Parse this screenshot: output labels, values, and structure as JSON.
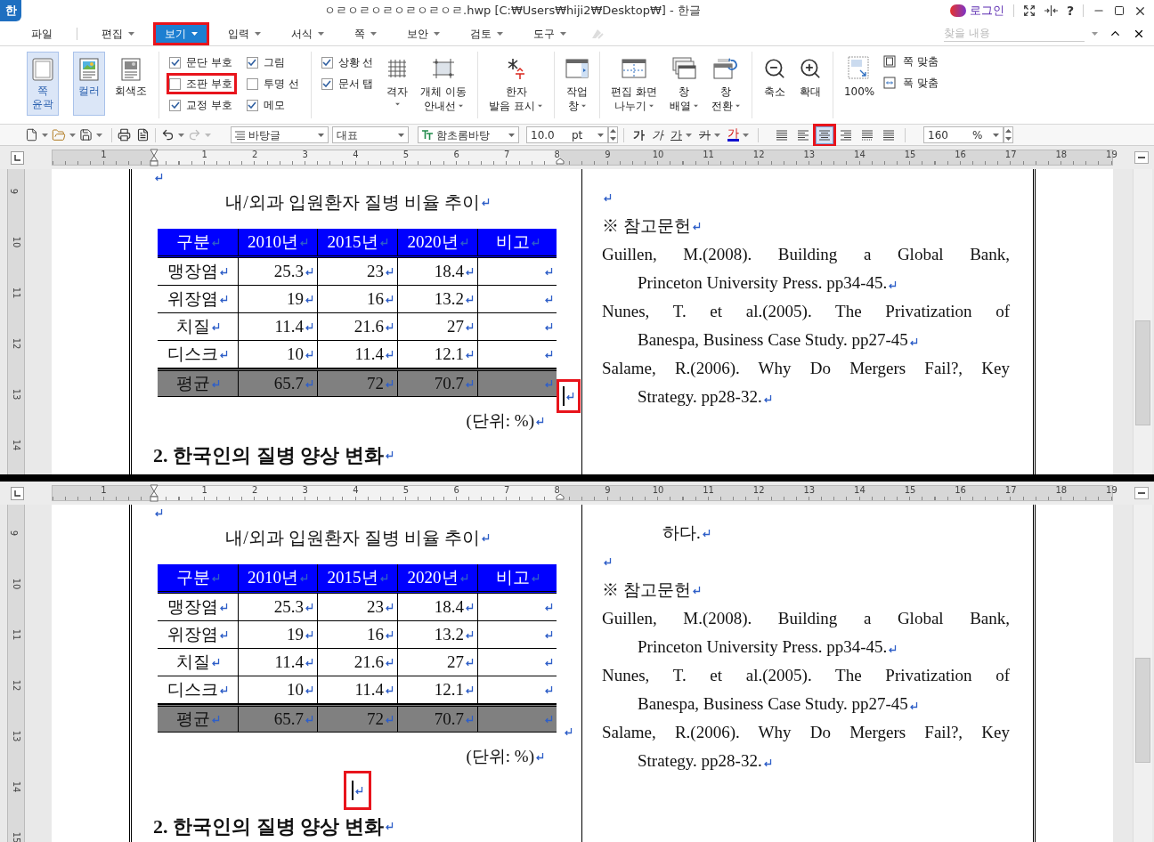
{
  "window": {
    "logo": "한",
    "title": "ㅇㄹㅇㄹㅇㄹㅇㄹㅇㄹㅇㄹ.hwp [C:₩Users₩hiji2₩Desktop₩] - 한글",
    "login": "로그인",
    "help": "?"
  },
  "menu": [
    {
      "label": "파일",
      "dropdown": false,
      "selected": false,
      "highlighted": false
    },
    {
      "label": "편집",
      "dropdown": true,
      "selected": false,
      "highlighted": false
    },
    {
      "label": "보기",
      "dropdown": true,
      "selected": true,
      "highlighted": true
    },
    {
      "label": "입력",
      "dropdown": true,
      "selected": false,
      "highlighted": false
    },
    {
      "label": "서식",
      "dropdown": true,
      "selected": false,
      "highlighted": false
    },
    {
      "label": "쪽",
      "dropdown": true,
      "selected": false,
      "highlighted": false
    },
    {
      "label": "보안",
      "dropdown": true,
      "selected": false,
      "highlighted": false
    },
    {
      "label": "검토",
      "dropdown": true,
      "selected": false,
      "highlighted": false
    },
    {
      "label": "도구",
      "dropdown": true,
      "selected": false,
      "highlighted": false
    }
  ],
  "search": {
    "placeholder": "찾을 내용"
  },
  "ribbon": {
    "groups": [
      {
        "toggles": [
          {
            "lines": [
              "쪽",
              "윤곽"
            ],
            "selected": true
          }
        ]
      },
      {
        "toggles": [
          {
            "lines": [
              "컬러"
            ],
            "selected": true
          },
          {
            "lines": [
              "회색조"
            ],
            "selected": false
          }
        ]
      },
      {
        "checks": [
          {
            "label": "문단 부호",
            "checked": true,
            "highlighted": false
          },
          {
            "label": "조판 부호",
            "checked": false,
            "highlighted": true
          },
          {
            "label": "교정 부호",
            "checked": true,
            "highlighted": false
          },
          {
            "label": "그림",
            "checked": true,
            "highlighted": false
          },
          {
            "label": "투명 선",
            "checked": false,
            "highlighted": false
          },
          {
            "label": "메모",
            "checked": true,
            "highlighted": false
          }
        ]
      },
      {
        "checks": [
          {
            "label": "상황 선",
            "checked": true,
            "highlighted": false
          },
          {
            "label": "문서 탭",
            "checked": true,
            "highlighted": false
          }
        ],
        "tools": [
          {
            "lines": [
              "격자"
            ],
            "dropdown": true
          },
          {
            "lines": [
              "개체 이동",
              "안내선"
            ],
            "dropdown": true
          }
        ]
      },
      {
        "tools": [
          {
            "lines": [
              "한자",
              "발음 표시"
            ],
            "dropdown": true
          }
        ]
      },
      {
        "tools": [
          {
            "lines": [
              "작업",
              "창"
            ],
            "dropdown": true
          }
        ]
      },
      {
        "tools": [
          {
            "lines": [
              "편집 화면",
              "나누기"
            ],
            "dropdown": true
          },
          {
            "lines": [
              "창",
              "배열"
            ],
            "dropdown": true
          },
          {
            "lines": [
              "창",
              "전환"
            ],
            "dropdown": true
          }
        ]
      },
      {
        "tools": [
          {
            "lines": [
              "축소"
            ],
            "dropdown": false
          },
          {
            "lines": [
              "확대"
            ],
            "dropdown": false
          }
        ]
      },
      {
        "tools": [
          {
            "lines": [
              "100%"
            ],
            "dropdown": false
          }
        ],
        "fits": [
          {
            "label": "쪽 맞춤"
          },
          {
            "label": "폭 맞춤"
          }
        ]
      }
    ]
  },
  "toolbar": {
    "style": "바탕글",
    "lang": "대표",
    "font": "함초롬바탕",
    "size": "10.0",
    "size_unit": "pt",
    "char_buttons": [
      {
        "kind": "bold",
        "label": "가",
        "dropdown": false
      },
      {
        "kind": "italic",
        "label": "가",
        "dropdown": false
      },
      {
        "kind": "underline",
        "label": "가",
        "dropdown": true
      },
      {
        "kind": "strike",
        "label": "가",
        "dropdown": true
      },
      {
        "kind": "color",
        "label": "가",
        "dropdown": true
      }
    ],
    "aligns": [
      {
        "kind": "justify",
        "selected": false,
        "highlighted": false
      },
      {
        "kind": "left",
        "selected": false,
        "highlighted": false
      },
      {
        "kind": "center",
        "selected": true,
        "highlighted": true
      },
      {
        "kind": "right",
        "selected": false,
        "highlighted": false
      },
      {
        "kind": "distribute",
        "selected": false,
        "highlighted": false
      },
      {
        "kind": "divide",
        "selected": false,
        "highlighted": false
      }
    ],
    "line_spacing": "160",
    "line_spacing_unit": "%"
  },
  "views": [
    {
      "ruler_labels": [
        "1",
        "1",
        "2",
        "3",
        "4",
        "5",
        "6",
        "7",
        "8",
        "9",
        "10",
        "11",
        "12",
        "13",
        "14",
        "15",
        "16",
        "17",
        "18",
        "19"
      ],
      "vruler_labels": [
        "9",
        "10",
        "11",
        "12",
        "13",
        "14"
      ],
      "left": [
        {
          "kind": "empty"
        },
        {
          "kind": "caption",
          "text": "내/외과 입원환자 질병 비율 추이"
        },
        {
          "kind": "table",
          "columns": [
            "구분",
            "2010년",
            "2015년",
            "2020년",
            "비고"
          ],
          "rows": [
            [
              "맹장염",
              "25.3",
              "23",
              "18.4"
            ],
            [
              "위장염",
              "19",
              "16",
              "13.2"
            ],
            [
              "치질",
              "11.4",
              "21.6",
              "27"
            ],
            [
              "디스크",
              "10",
              "11.4",
              "12.1"
            ]
          ],
          "summary": [
            "평균",
            "65.7",
            "72",
            "70.7"
          ],
          "end_cursor": true,
          "end_highlighted": true
        },
        {
          "kind": "unit",
          "text": "(단위: %)"
        },
        {
          "kind": "heading",
          "text": "2. 한국인의 질병 양상 변화"
        }
      ],
      "right": [
        {
          "kind": "empty"
        },
        {
          "kind": "note",
          "text": "※ 참고문헌"
        },
        {
          "kind": "reference",
          "lines": [
            "Guillen, M.(2008). Building a Global Bank,",
            "Princeton University Press. pp34-45."
          ]
        },
        {
          "kind": "reference",
          "lines": [
            "Nunes, T. et al.(2005). The Privatization of",
            "Banespa, Business Case Study. pp27-45"
          ]
        },
        {
          "kind": "reference",
          "lines": [
            "Salame, R.(2006). Why Do Mergers Fail?, Key",
            "Strategy. pp28-32."
          ]
        }
      ]
    },
    {
      "ruler_labels": [
        "1",
        "1",
        "2",
        "3",
        "4",
        "5",
        "6",
        "7",
        "8",
        "9",
        "10",
        "11",
        "12",
        "13",
        "14",
        "15",
        "16",
        "17",
        "18",
        "19"
      ],
      "vruler_labels": [
        "9",
        "10",
        "11",
        "12",
        "13",
        "14",
        "15"
      ],
      "left": [
        {
          "kind": "empty"
        },
        {
          "kind": "caption",
          "text": "내/외과 입원환자 질병 비율 추이"
        },
        {
          "kind": "table",
          "columns": [
            "구분",
            "2010년",
            "2015년",
            "2020년",
            "비고"
          ],
          "rows": [
            [
              "맹장염",
              "25.3",
              "23",
              "18.4"
            ],
            [
              "위장염",
              "19",
              "16",
              "13.2"
            ],
            [
              "치질",
              "11.4",
              "21.6",
              "27"
            ],
            [
              "디스크",
              "10",
              "11.4",
              "12.1"
            ]
          ],
          "summary": [
            "평균",
            "65.7",
            "72",
            "70.7"
          ],
          "end_cursor": false,
          "end_highlighted": false
        },
        {
          "kind": "unit",
          "text": "(단위: %)"
        },
        {
          "kind": "cursor_line",
          "cursor": true,
          "highlighted": true
        },
        {
          "kind": "heading",
          "text": "2. 한국인의 질병 양상 변화"
        }
      ],
      "right": [
        {
          "kind": "continuation",
          "text": "하다."
        },
        {
          "kind": "empty"
        },
        {
          "kind": "note",
          "text": "※ 참고문헌"
        },
        {
          "kind": "reference",
          "lines": [
            "Guillen, M.(2008). Building a Global Bank,",
            "Princeton University Press. pp34-45."
          ]
        },
        {
          "kind": "reference",
          "lines": [
            "Nunes, T. et al.(2005). The Privatization of",
            "Banespa, Business Case Study. pp27-45"
          ]
        },
        {
          "kind": "reference",
          "lines": [
            "Salame, R.(2006). Why Do Mergers Fail?, Key",
            "Strategy. pp28-32."
          ]
        }
      ]
    }
  ]
}
